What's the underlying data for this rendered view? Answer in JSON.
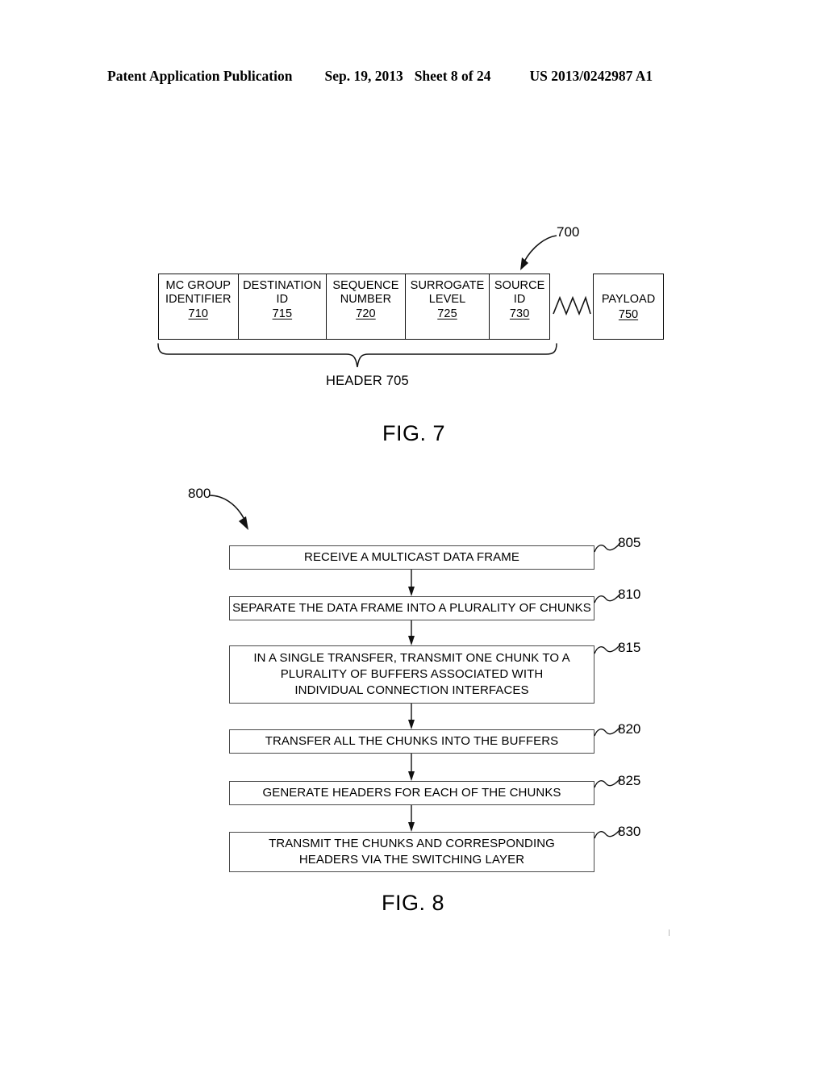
{
  "page_header": {
    "publication": "Patent Application Publication",
    "date": "Sep. 19, 2013",
    "sheet": "Sheet 8 of 24",
    "patent_number": "US 2013/0242987 A1"
  },
  "figure7": {
    "caption": "FIG. 7",
    "diagram_ref": "700",
    "header_brace_label": "HEADER  705",
    "cells": [
      {
        "line1": "MC GROUP",
        "line2": "IDENTIFIER",
        "ref": "710"
      },
      {
        "line1": "DESTINATION",
        "line2": "ID",
        "ref": "715"
      },
      {
        "line1": "SEQUENCE",
        "line2": "NUMBER",
        "ref": "720"
      },
      {
        "line1": "SURROGATE",
        "line2": "LEVEL",
        "ref": "725"
      },
      {
        "line1": "SOURCE",
        "line2": "ID",
        "ref": "730"
      }
    ],
    "payload": {
      "label": "PAYLOAD",
      "ref": "750"
    },
    "break_symbol": "zigzag-break"
  },
  "figure8": {
    "caption": "FIG. 8",
    "diagram_ref": "800",
    "steps": [
      {
        "ref": "805",
        "lines": [
          "RECEIVE A MULTICAST DATA FRAME"
        ]
      },
      {
        "ref": "810",
        "lines": [
          "SEPARATE THE DATA FRAME INTO A PLURALITY OF CHUNKS"
        ]
      },
      {
        "ref": "815",
        "lines": [
          "IN A SINGLE TRANSFER, TRANSMIT ONE CHUNK TO A",
          "PLURALITY OF BUFFERS ASSOCIATED WITH",
          "INDIVIDUAL CONNECTION INTERFACES"
        ]
      },
      {
        "ref": "820",
        "lines": [
          "TRANSFER ALL THE CHUNKS INTO THE BUFFERS"
        ]
      },
      {
        "ref": "825",
        "lines": [
          "GENERATE HEADERS FOR EACH OF THE CHUNKS"
        ]
      },
      {
        "ref": "830",
        "lines": [
          "TRANSMIT THE CHUNKS AND CORRESPONDING",
          "HEADERS VIA THE SWITCHING LAYER"
        ]
      }
    ]
  },
  "colors": {
    "ink": "#000000",
    "box_stroke": "#4a4a4a",
    "page_background": "#ffffff"
  }
}
